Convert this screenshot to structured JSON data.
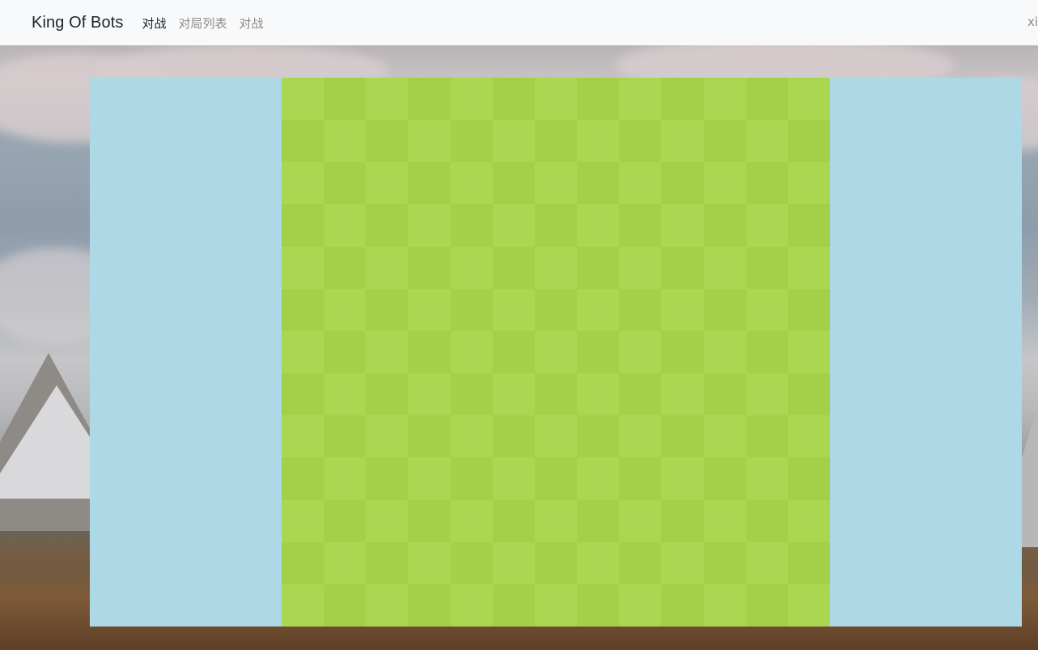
{
  "navbar": {
    "brand": "King Of Bots",
    "links": [
      {
        "label": "对战",
        "active": true
      },
      {
        "label": "对局列表",
        "active": false
      },
      {
        "label": "对战",
        "active": false
      }
    ],
    "user": "xi"
  },
  "playground": {
    "background_color": "#add8e6",
    "board": {
      "rows": 13,
      "cols": 13,
      "light_color": "#aad751",
      "dark_color": "#a2d149"
    }
  }
}
